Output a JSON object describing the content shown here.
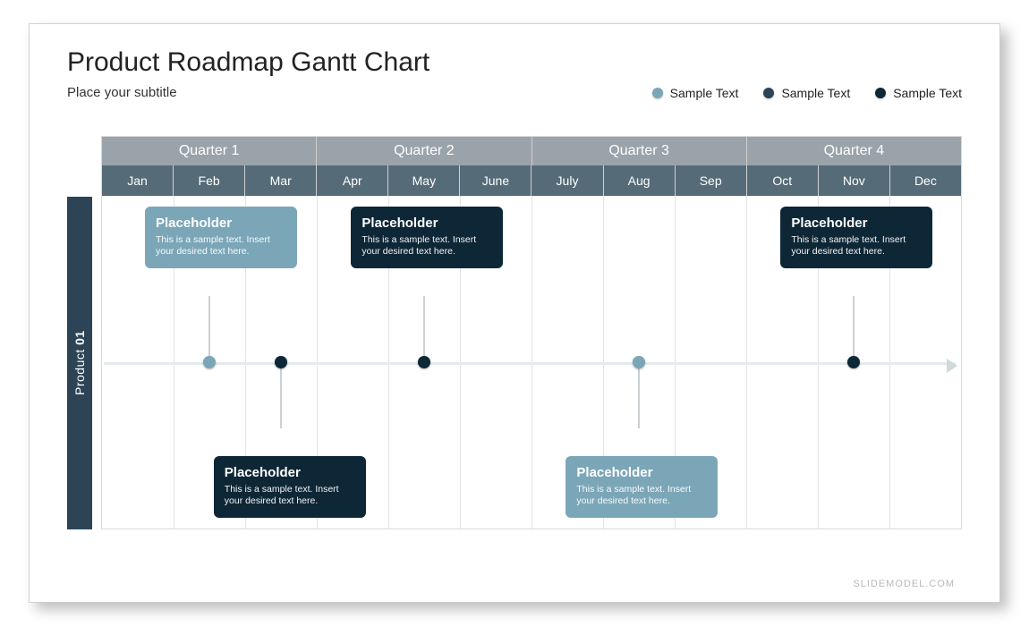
{
  "title": "Product Roadmap Gantt Chart",
  "subtitle": "Place your subtitle",
  "legend": [
    {
      "label": "Sample Text",
      "color": "#7ba6b8"
    },
    {
      "label": "Sample Text",
      "color": "#2c4456"
    },
    {
      "label": "Sample Text",
      "color": "#0e2737"
    }
  ],
  "quarters": [
    "Quarter 1",
    "Quarter 2",
    "Quarter 3",
    "Quarter 4"
  ],
  "months": [
    "Jan",
    "Feb",
    "Mar",
    "Apr",
    "May",
    "June",
    "July",
    "Aug",
    "Sep",
    "Oct",
    "Nov",
    "Dec"
  ],
  "row_label_a": "Product ",
  "row_label_b": "01",
  "cards": {
    "c1": {
      "title": "Placeholder",
      "body": "This is a sample text. Insert your desired text here."
    },
    "c2": {
      "title": "Placeholder",
      "body": "This is a sample text. Insert your desired text here."
    },
    "c3": {
      "title": "Placeholder",
      "body": "This is a sample text. Insert your desired text here."
    },
    "c4": {
      "title": "Placeholder",
      "body": "This is a sample text. Insert your desired text here."
    },
    "c5": {
      "title": "Placeholder",
      "body": "This is a sample text. Insert your desired text here."
    }
  },
  "footer": "SLIDEMODEL.COM",
  "chart_data": {
    "type": "gantt-timeline",
    "title": "Product Roadmap Gantt Chart",
    "categories": [
      "Jan",
      "Feb",
      "Mar",
      "Apr",
      "May",
      "June",
      "July",
      "Aug",
      "Sep",
      "Oct",
      "Nov",
      "Dec"
    ],
    "quarters": [
      "Quarter 1",
      "Quarter 2",
      "Quarter 3",
      "Quarter 4"
    ],
    "rows": [
      {
        "name": "Product 01",
        "milestones": [
          {
            "month": "Feb",
            "month_index": 2,
            "color": "#7ba6b8",
            "position": "above",
            "title": "Placeholder",
            "text": "This is a sample text. Insert your desired text here."
          },
          {
            "month": "Mar",
            "month_index": 3,
            "color": "#0e2737",
            "position": "below",
            "title": "Placeholder",
            "text": "This is a sample text. Insert your desired text here."
          },
          {
            "month": "May",
            "month_index": 5,
            "color": "#0e2737",
            "position": "above",
            "title": "Placeholder",
            "text": "This is a sample text. Insert your desired text here."
          },
          {
            "month": "Aug",
            "month_index": 8,
            "color": "#7ba6b8",
            "position": "below",
            "title": "Placeholder",
            "text": "This is a sample text. Insert your desired text here."
          },
          {
            "month": "Nov",
            "month_index": 11,
            "color": "#0e2737",
            "position": "above",
            "title": "Placeholder",
            "text": "This is a sample text. Insert your desired text here."
          }
        ]
      }
    ],
    "legend": [
      {
        "name": "Sample Text",
        "color": "#7ba6b8"
      },
      {
        "name": "Sample Text",
        "color": "#2c4456"
      },
      {
        "name": "Sample Text",
        "color": "#0e2737"
      }
    ]
  }
}
